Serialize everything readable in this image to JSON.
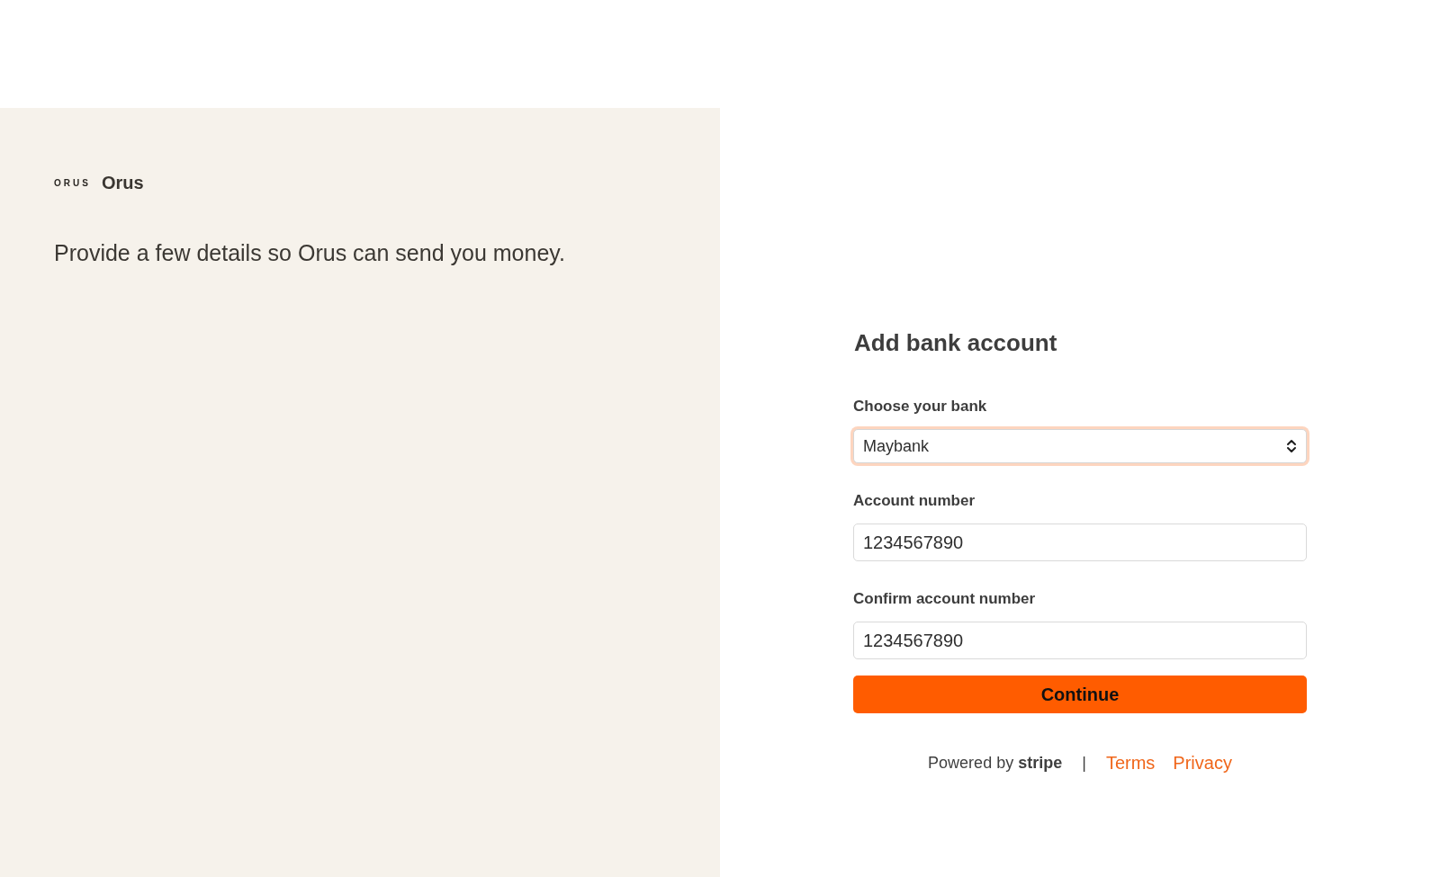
{
  "brand": {
    "logo": "ORUS",
    "name": "Orus"
  },
  "tagline": "Provide a few details so Orus can send you money.",
  "form": {
    "title": "Add bank account",
    "fields": [
      {
        "kind": "select",
        "label": "Choose your bank",
        "value": "Maybank",
        "focused": true
      },
      {
        "kind": "text",
        "label": "Account number",
        "value": "1234567890",
        "focused": false
      },
      {
        "kind": "text",
        "label": "Confirm account number",
        "value": "1234567890",
        "focused": false
      }
    ],
    "submit": "Continue"
  },
  "footer": {
    "powered_by": "Powered by **stripe**",
    "separator": "|",
    "links": [
      "Terms",
      "Privacy"
    ]
  }
}
